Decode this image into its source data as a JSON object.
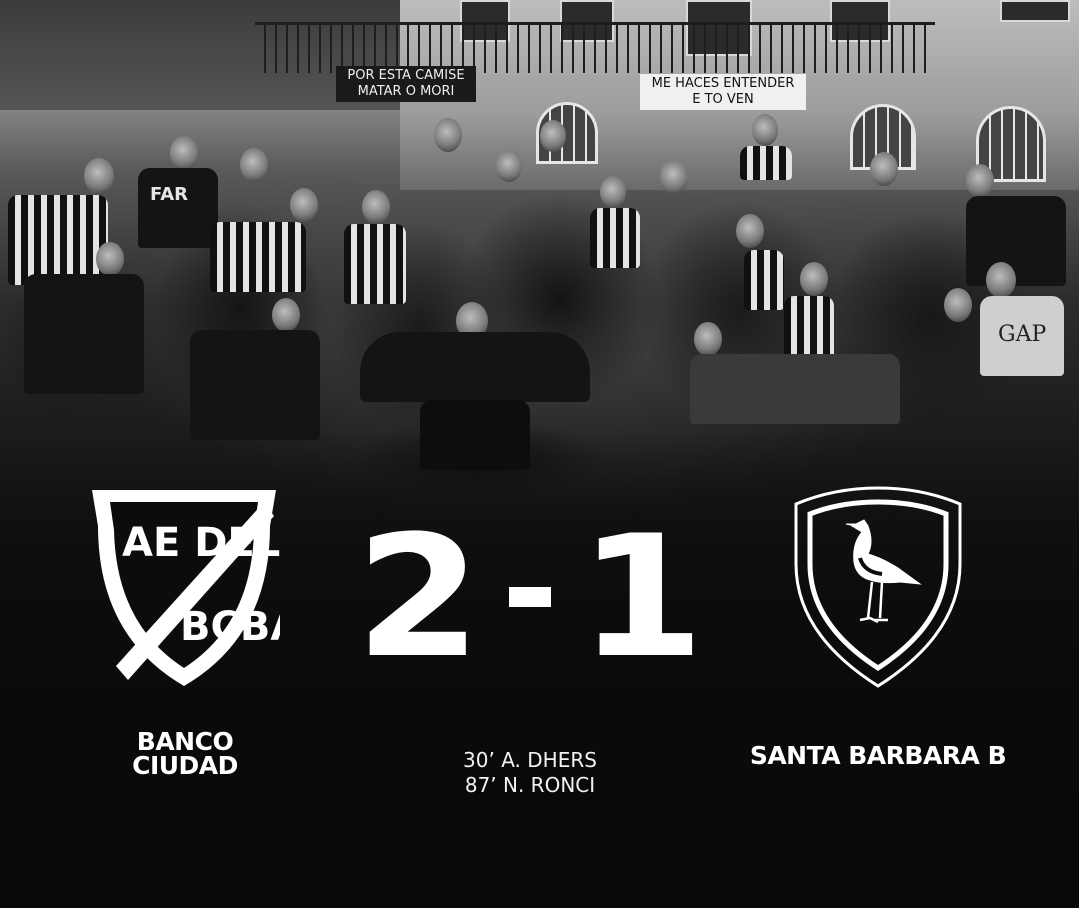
{
  "photo": {
    "banner_left_lines": [
      "POR ESTA CAMISE",
      "MATAR O MORI"
    ],
    "banner_right_lines": [
      "ME HACES ENTENDER",
      "E TO VEN"
    ],
    "jersey_text": "FAR",
    "sweater_text": "GAP"
  },
  "home_team": {
    "crest_lines": [
      "AE DEL",
      "BCBA"
    ],
    "name_line1": "BANCO",
    "name_line2": "CIUDAD"
  },
  "away_team": {
    "name": "SANTA BARBARA B"
  },
  "score": {
    "home": "2",
    "separator": "-",
    "away": "1"
  },
  "scorers": [
    "30’ A. DHERS",
    "87’ N. RONCI"
  ],
  "colors": {
    "text": "#ffffff",
    "background": "#0c0c0c"
  }
}
